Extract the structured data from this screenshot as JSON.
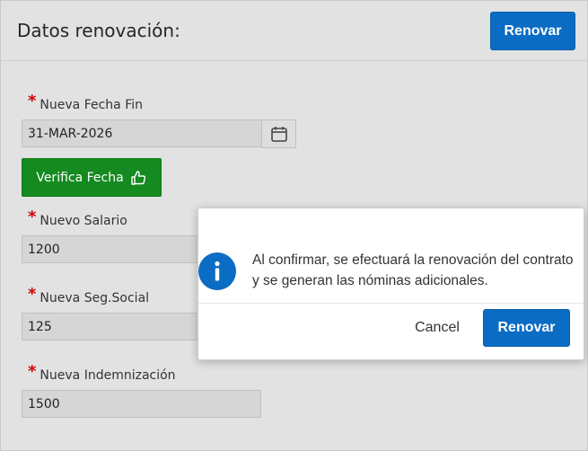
{
  "header": {
    "title": "Datos renovación:",
    "renew_label": "Renovar"
  },
  "form": {
    "fecha_fin": {
      "label": "Nueva Fecha Fin",
      "value": "31-MAR-2026",
      "required": "*"
    },
    "verify_label": "Verifica Fecha",
    "salario": {
      "label": "Nuevo Salario",
      "value": "1200",
      "required": "*"
    },
    "seg_social": {
      "label": "Nueva Seg.Social",
      "value": "125",
      "required": "*"
    },
    "indemnizacion": {
      "label": "Nueva Indemnización",
      "value": "1500",
      "required": "*"
    }
  },
  "dialog": {
    "message": "Al confirmar, se efectuará la renovación del contrato y se generan las nóminas adicionales.",
    "cancel_label": "Cancel",
    "confirm_label": "Renovar"
  },
  "colors": {
    "primary": "#0b6cc3",
    "success": "#148a20",
    "required": "#d20000"
  },
  "icons": {
    "calendar": "calendar-icon",
    "thumbs_up": "thumbs-up-icon",
    "info": "info-icon"
  }
}
